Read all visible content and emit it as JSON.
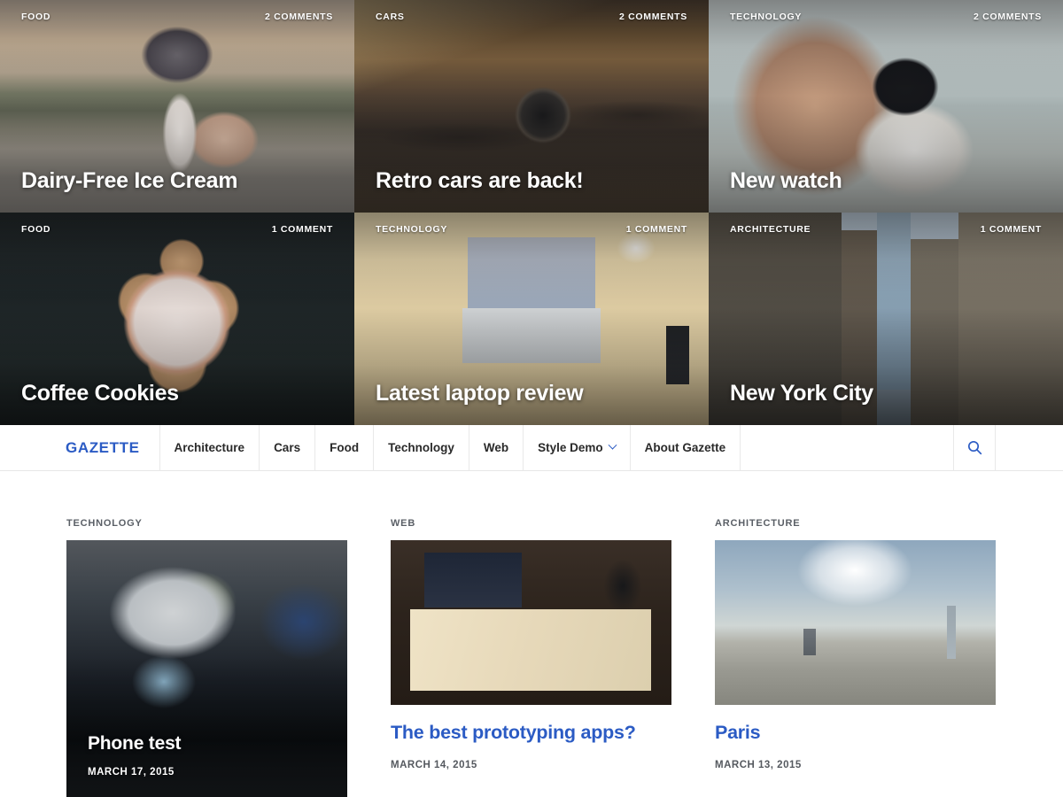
{
  "featured": [
    {
      "category": "FOOD",
      "comments": "2 COMMENTS",
      "title": "Dairy-Free Ice Cream",
      "art": "art-icecream"
    },
    {
      "category": "CARS",
      "comments": "2 COMMENTS",
      "title": "Retro cars are back!",
      "art": "art-car"
    },
    {
      "category": "TECHNOLOGY",
      "comments": "2 COMMENTS",
      "title": "New watch",
      "art": "art-watch"
    },
    {
      "category": "FOOD",
      "comments": "1 COMMENT",
      "title": "Coffee Cookies",
      "art": "art-cookies"
    },
    {
      "category": "TECHNOLOGY",
      "comments": "1 COMMENT",
      "title": "Latest laptop review",
      "art": "art-laptop"
    },
    {
      "category": "ARCHITECTURE",
      "comments": "1 COMMENT",
      "title": "New York City",
      "art": "art-nyc"
    }
  ],
  "nav": {
    "logo": "GAZETTE",
    "items": [
      {
        "label": "Architecture",
        "has_caret": false
      },
      {
        "label": "Cars",
        "has_caret": false
      },
      {
        "label": "Food",
        "has_caret": false
      },
      {
        "label": "Technology",
        "has_caret": false
      },
      {
        "label": "Web",
        "has_caret": false
      },
      {
        "label": "Style Demo",
        "has_caret": true
      },
      {
        "label": "About Gazette",
        "has_caret": false
      }
    ],
    "search_icon": "search-icon"
  },
  "articles": [
    {
      "category": "TECHNOLOGY",
      "title": "Phone test",
      "date": "MARCH 17, 2015",
      "art": "art-phone",
      "title_over_image": true
    },
    {
      "category": "WEB",
      "title": "The best prototyping apps?",
      "date": "MARCH 14, 2015",
      "art": "art-notebook",
      "title_over_image": false
    },
    {
      "category": "ARCHITECTURE",
      "title": "Paris",
      "date": "MARCH 13, 2015",
      "art": "art-paris",
      "title_over_image": false
    }
  ],
  "colors": {
    "accent_blue": "#2b5bc4",
    "text_dark": "#2a2a2a",
    "meta_gray": "#55595f",
    "border_gray": "#e9e9e9",
    "overlay_text": "#ffffff"
  }
}
